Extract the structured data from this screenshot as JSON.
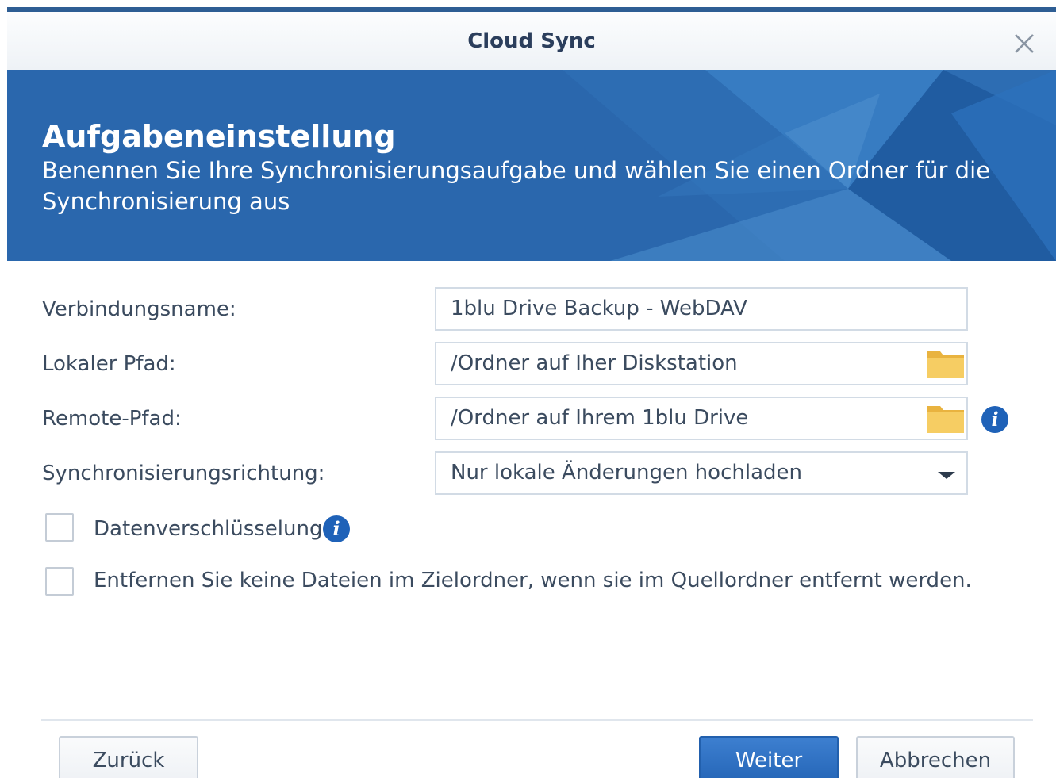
{
  "window": {
    "title": "Cloud Sync"
  },
  "banner": {
    "title": "Aufgabeneinstellung",
    "subtitle": "Benennen Sie Ihre Synchronisierungsaufgabe und wählen Sie einen Ordner für die Synchronisierung aus"
  },
  "form": {
    "connection_name": {
      "label": "Verbindungsname:",
      "value": "1blu Drive Backup - WebDAV"
    },
    "local_path": {
      "label": "Lokaler Pfad:",
      "value": "/Ordner auf Iher Diskstation"
    },
    "remote_path": {
      "label": "Remote-Pfad:",
      "value": "/Ordner auf Ihrem 1blu Drive"
    },
    "sync_direction": {
      "label": "Synchronisierungsrichtung:",
      "value": "Nur lokale Änderungen hochladen"
    },
    "encryption": {
      "label": "Datenverschlüsselung",
      "checked": false
    },
    "no_delete": {
      "label": "Entfernen Sie keine Dateien im Zielordner, wenn sie im Quellordner entfernt werden.",
      "checked": false
    }
  },
  "icons": {
    "info_glyph": "i"
  },
  "buttons": {
    "back": "Zurück",
    "next": "Weiter",
    "cancel": "Abbrechen"
  },
  "colors": {
    "accent": "#2465b6",
    "banner": "#2a67ad",
    "folder": "#f5c85a"
  }
}
